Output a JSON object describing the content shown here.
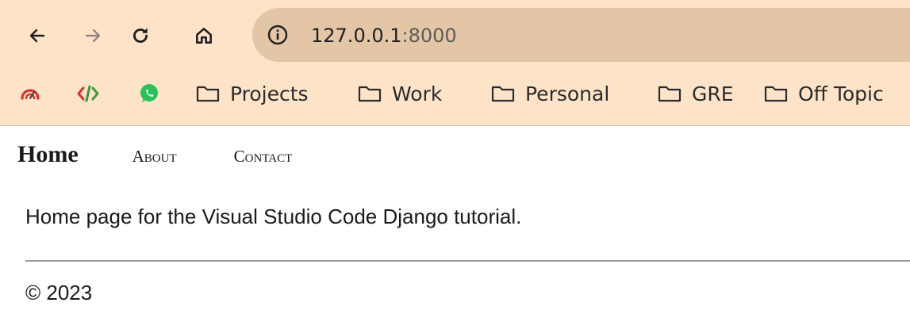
{
  "browser": {
    "url_host": "127.0.0.1",
    "url_port": ":8000",
    "icons": {
      "back": "arrow-left-icon",
      "forward": "arrow-right-icon",
      "reload": "reload-icon",
      "home": "home-icon",
      "site_info": "info-icon"
    },
    "bookmarks": [
      {
        "icon": "speedometer-icon",
        "label": ""
      },
      {
        "icon": "code-icon",
        "label": ""
      },
      {
        "icon": "whatsapp-icon",
        "label": ""
      },
      {
        "icon": "folder-icon",
        "label": "Projects"
      },
      {
        "icon": "folder-icon",
        "label": "Work"
      },
      {
        "icon": "folder-icon",
        "label": "Personal"
      },
      {
        "icon": "folder-icon",
        "label": "GRE"
      },
      {
        "icon": "folder-icon",
        "label": "Off Topic"
      }
    ],
    "colors": {
      "toolbar_bg": "#fde3c8",
      "omnibox_bg": "#e2c6a6"
    }
  },
  "page": {
    "nav": {
      "home": "Home",
      "about": "About",
      "contact": "Contact"
    },
    "intro": "Home page for the Visual Studio Code Django tutorial.",
    "footer": "© 2023"
  }
}
